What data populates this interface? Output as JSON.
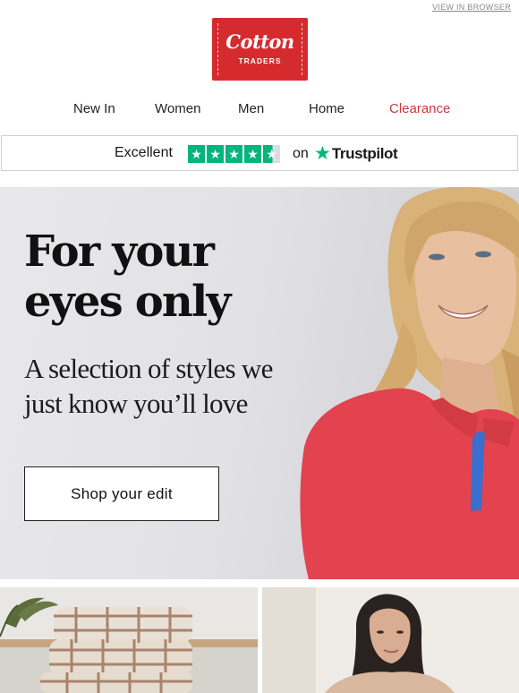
{
  "header": {
    "view_in_browser": "VIEW IN BROWSER",
    "logo": {
      "main": "Cotton",
      "sub": "TRADERS",
      "color": "#d52b2e"
    }
  },
  "nav": {
    "items": [
      {
        "label": "New In"
      },
      {
        "label": "Women"
      },
      {
        "label": "Men"
      },
      {
        "label": "Home"
      },
      {
        "label": "Clearance",
        "color": "#c43b3f"
      }
    ]
  },
  "trustpilot": {
    "rating_text": "Excellent",
    "on_text": "on",
    "brand": "Trustpilot",
    "stars_rating": 4.5,
    "star_color": "#00b67a"
  },
  "hero": {
    "title_line1": "For your",
    "title_line2": "eyes only",
    "subtitle_line1": "A selection of styles we",
    "subtitle_line2": "just know you’ll love",
    "button_label": "Shop your edit"
  },
  "tiles": [
    {
      "subject": "folded-check-blankets"
    },
    {
      "subject": "woman-portrait"
    }
  ]
}
